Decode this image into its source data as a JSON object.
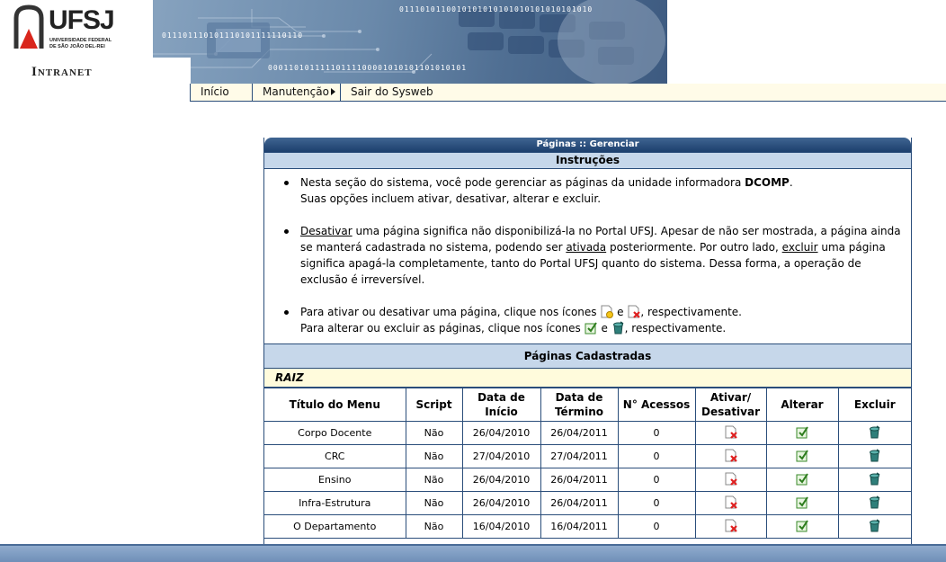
{
  "header": {
    "logo_text": "UFSJ",
    "logo_sub": [
      "UNIVERSIDADE FEDERAL",
      "DE SÃO JOÃO DEL-REI"
    ],
    "intranet_label": "Intranet",
    "binary_lines": [
      "0111010110010101010101010101010101010",
      "011101110101110101111110110",
      "00011010111110111100001010101101010101"
    ]
  },
  "menu": {
    "items": [
      {
        "label": "Início"
      },
      {
        "label": "Manutenção"
      },
      {
        "label": "Sair do Sysweb"
      }
    ]
  },
  "panel": {
    "title": "Páginas :: Gerenciar",
    "instructions_title": "Instruções",
    "bullet1": {
      "line1_pre": "Nesta seção do sistema, você pode gerenciar as páginas da unidade informadora ",
      "unit": "DCOMP",
      "line1_post": ".",
      "line2": "Suas opções incluem ativar, desativar, alterar e excluir."
    },
    "bullet2": {
      "w1": "Desativar",
      "t1": " uma página significa não disponibilizá-la no Portal UFSJ. Apesar de não ser mostrada, a página ainda se manterá cadastrada no sistema, podendo ser ",
      "w2": "ativada",
      "t2": " posteriormente. Por outro lado, ",
      "w3": "excluir",
      "t3": " uma página significa apagá-la completamente, tanto do Portal UFSJ quanto do sistema. Dessa forma, a operação de exclusão é irreversível."
    },
    "bullet3": {
      "l1_pre": "Para ativar ou desativar uma página, clique nos ícones ",
      "l1_and": " e ",
      "l1_post": ", respectivamente.",
      "l2_pre": "Para alterar ou excluir as páginas, clique nos ícones ",
      "l2_and": " e ",
      "l2_post": ", respectivamente."
    },
    "registered_title": "Páginas Cadastradas",
    "group_label": "RAIZ",
    "table": {
      "headers": [
        "Título do Menu",
        "Script",
        "Data de Início",
        "Data de Término",
        "N° Acessos",
        "Ativar/ Desativar",
        "Alterar",
        "Excluir"
      ],
      "rows": [
        {
          "title": "Corpo Docente",
          "script": "Não",
          "start": "26/04/2010",
          "end": "26/04/2011",
          "hits": "0"
        },
        {
          "title": "CRC",
          "script": "Não",
          "start": "27/04/2010",
          "end": "27/04/2011",
          "hits": "0"
        },
        {
          "title": "Ensino",
          "script": "Não",
          "start": "26/04/2010",
          "end": "26/04/2011",
          "hits": "0"
        },
        {
          "title": "Infra-Estrutura",
          "script": "Não",
          "start": "26/04/2010",
          "end": "26/04/2011",
          "hits": "0"
        },
        {
          "title": "O Departamento",
          "script": "Não",
          "start": "16/04/2010",
          "end": "16/04/2011",
          "hits": "0"
        }
      ]
    }
  },
  "colors": {
    "accent": "#2a4d7a",
    "section": "#c6d7ea",
    "highlight": "#fffbdc"
  },
  "icons": {
    "activate": "page-activate-icon",
    "deactivate": "page-deactivate-icon",
    "edit": "edit-icon",
    "delete": "delete-icon"
  }
}
